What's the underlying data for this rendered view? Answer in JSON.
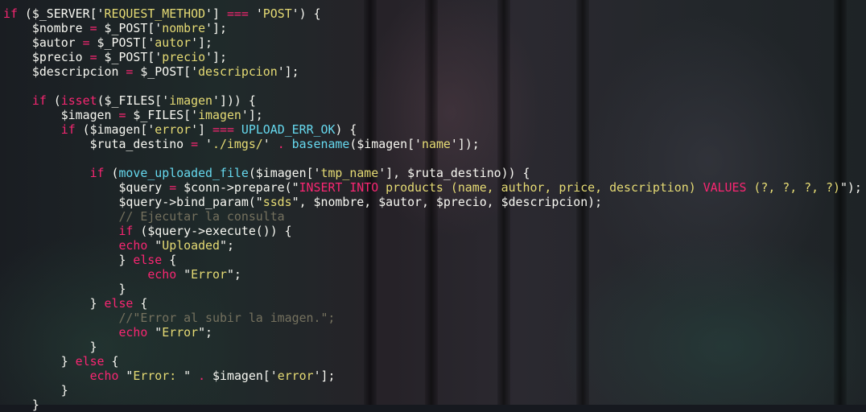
{
  "editor": {
    "lines": [
      [
        [
          "kw",
          "if"
        ],
        [
          "plain",
          " ($_SERVER['"
        ],
        [
          "str",
          "REQUEST_METHOD"
        ],
        [
          "plain",
          "'] "
        ],
        [
          "kw",
          "==="
        ],
        [
          "plain",
          " '"
        ],
        [
          "str",
          "POST"
        ],
        [
          "plain",
          "') {"
        ]
      ],
      [
        [
          "plain",
          "    $nombre "
        ],
        [
          "kw",
          "="
        ],
        [
          "plain",
          " $_POST['"
        ],
        [
          "str",
          "nombre"
        ],
        [
          "plain",
          "'];"
        ]
      ],
      [
        [
          "plain",
          "    $autor "
        ],
        [
          "kw",
          "="
        ],
        [
          "plain",
          " $_POST['"
        ],
        [
          "str",
          "autor"
        ],
        [
          "plain",
          "'];"
        ]
      ],
      [
        [
          "plain",
          "    $precio "
        ],
        [
          "kw",
          "="
        ],
        [
          "plain",
          " $_POST['"
        ],
        [
          "str",
          "precio"
        ],
        [
          "plain",
          "'];"
        ]
      ],
      [
        [
          "plain",
          "    $descripcion "
        ],
        [
          "kw",
          "="
        ],
        [
          "plain",
          " $_POST['"
        ],
        [
          "str",
          "descripcion"
        ],
        [
          "plain",
          "'];"
        ]
      ],
      [
        [
          "plain",
          ""
        ]
      ],
      [
        [
          "plain",
          "    "
        ],
        [
          "kw",
          "if"
        ],
        [
          "plain",
          " ("
        ],
        [
          "kw",
          "isset"
        ],
        [
          "plain",
          "($_FILES['"
        ],
        [
          "str",
          "imagen"
        ],
        [
          "plain",
          "'])) {"
        ]
      ],
      [
        [
          "plain",
          "        $imagen "
        ],
        [
          "kw",
          "="
        ],
        [
          "plain",
          " $_FILES['"
        ],
        [
          "str",
          "imagen"
        ],
        [
          "plain",
          "'];"
        ]
      ],
      [
        [
          "plain",
          "        "
        ],
        [
          "kw",
          "if"
        ],
        [
          "plain",
          " ($imagen['"
        ],
        [
          "str",
          "error"
        ],
        [
          "plain",
          "'] "
        ],
        [
          "kw",
          "==="
        ],
        [
          "plain",
          " "
        ],
        [
          "const",
          "UPLOAD_ERR_OK"
        ],
        [
          "plain",
          ") {"
        ]
      ],
      [
        [
          "plain",
          "            $ruta_destino "
        ],
        [
          "kw",
          "="
        ],
        [
          "plain",
          " '"
        ],
        [
          "str",
          "./imgs/"
        ],
        [
          "plain",
          "' "
        ],
        [
          "kw",
          "."
        ],
        [
          "plain",
          " "
        ],
        [
          "fn",
          "basename"
        ],
        [
          "plain",
          "($imagen['"
        ],
        [
          "str",
          "name"
        ],
        [
          "plain",
          "']);"
        ]
      ],
      [
        [
          "plain",
          ""
        ]
      ],
      [
        [
          "plain",
          "            "
        ],
        [
          "kw",
          "if"
        ],
        [
          "plain",
          " ("
        ],
        [
          "fn",
          "move_uploaded_file"
        ],
        [
          "plain",
          "($imagen['"
        ],
        [
          "str",
          "tmp_name"
        ],
        [
          "plain",
          "'], $ruta_destino)) {"
        ]
      ],
      [
        [
          "plain",
          "                $query "
        ],
        [
          "kw",
          "="
        ],
        [
          "plain",
          " $conn->prepare(\""
        ],
        [
          "kw",
          "INSERT INTO"
        ],
        [
          "str",
          " products (name, author, price, description) "
        ],
        [
          "kw",
          "VALUES"
        ],
        [
          "str",
          " (?, ?, ?, ?)"
        ],
        [
          "plain",
          "\");"
        ]
      ],
      [
        [
          "plain",
          "                $query->bind_param(\""
        ],
        [
          "str",
          "ssds"
        ],
        [
          "plain",
          "\", $nombre, $autor, $precio, $descripcion);"
        ]
      ],
      [
        [
          "plain",
          "                "
        ],
        [
          "cm",
          "// Ejecutar la consulta"
        ]
      ],
      [
        [
          "plain",
          "                "
        ],
        [
          "kw",
          "if"
        ],
        [
          "plain",
          " ($query->execute()) {"
        ]
      ],
      [
        [
          "plain",
          "                "
        ],
        [
          "kw",
          "echo"
        ],
        [
          "plain",
          " \""
        ],
        [
          "str",
          "Uploaded"
        ],
        [
          "plain",
          "\";"
        ]
      ],
      [
        [
          "plain",
          "                } "
        ],
        [
          "kw",
          "else"
        ],
        [
          "plain",
          " {"
        ]
      ],
      [
        [
          "plain",
          "                    "
        ],
        [
          "kw",
          "echo"
        ],
        [
          "plain",
          " \""
        ],
        [
          "str",
          "Error"
        ],
        [
          "plain",
          "\";"
        ]
      ],
      [
        [
          "plain",
          "                }"
        ]
      ],
      [
        [
          "plain",
          "            } "
        ],
        [
          "kw",
          "else"
        ],
        [
          "plain",
          " {"
        ]
      ],
      [
        [
          "plain",
          "                "
        ],
        [
          "cm",
          "//\"Error al subir la imagen.\";"
        ]
      ],
      [
        [
          "plain",
          "                "
        ],
        [
          "kw",
          "echo"
        ],
        [
          "plain",
          " \""
        ],
        [
          "str",
          "Error"
        ],
        [
          "plain",
          "\";"
        ]
      ],
      [
        [
          "plain",
          "            }"
        ]
      ],
      [
        [
          "plain",
          "        } "
        ],
        [
          "kw",
          "else"
        ],
        [
          "plain",
          " {"
        ]
      ],
      [
        [
          "plain",
          "            "
        ],
        [
          "kw",
          "echo"
        ],
        [
          "plain",
          " \""
        ],
        [
          "str",
          "Error: "
        ],
        [
          "plain",
          "\" "
        ],
        [
          "kw",
          "."
        ],
        [
          "plain",
          " $imagen['"
        ],
        [
          "str",
          "error"
        ],
        [
          "plain",
          "'];"
        ]
      ],
      [
        [
          "plain",
          "        }"
        ]
      ],
      [
        [
          "plain",
          "    }"
        ]
      ]
    ]
  },
  "theme": {
    "keyword": "#f92672",
    "string": "#e6db74",
    "function": "#66d9ef",
    "comment": "#75715e",
    "text": "#f8f8f2"
  }
}
